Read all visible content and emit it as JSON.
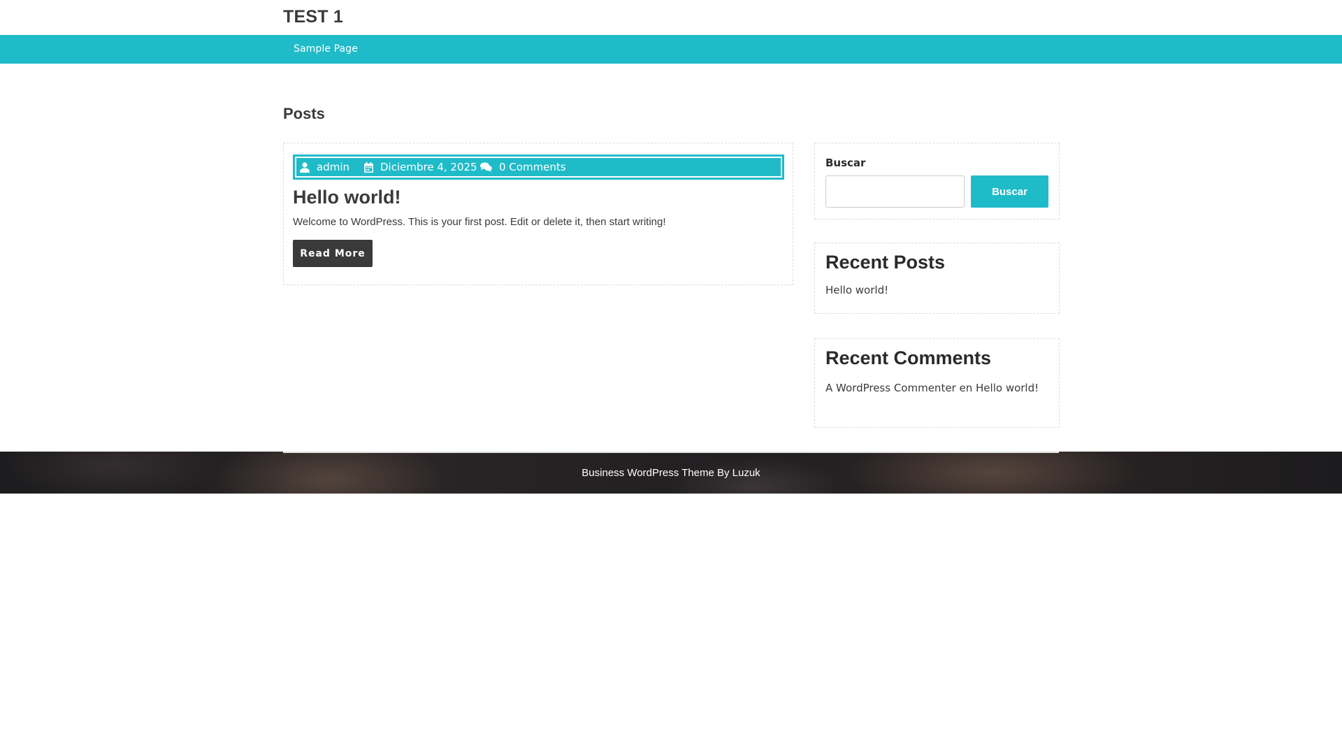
{
  "site": {
    "title": "TEST 1"
  },
  "nav": {
    "items": [
      {
        "label": "Sample Page"
      }
    ]
  },
  "main": {
    "heading": "Posts",
    "post": {
      "author": "admin",
      "date": "Diciembre 4, 2025",
      "comments": "0 Comments",
      "title": "Hello world!",
      "excerpt": "Welcome to WordPress. This is your first post. Edit or delete it, then start writing!",
      "read_more_label": "Read More"
    }
  },
  "sidebar": {
    "search": {
      "label": "Buscar",
      "button_label": "Buscar",
      "value": ""
    },
    "recent_posts": {
      "title": "Recent Posts",
      "items": [
        "Hello world!"
      ]
    },
    "recent_comments": {
      "title": "Recent Comments",
      "items": [
        {
          "author": "A WordPress Commenter",
          "connector": "en",
          "post": "Hello world!"
        }
      ]
    }
  },
  "footer": {
    "credit": "Business WordPress Theme By Luzuk"
  },
  "colors": {
    "accent": "#1fbbc9",
    "dark": "#3a3a3a",
    "footer_bg": "#222022"
  }
}
